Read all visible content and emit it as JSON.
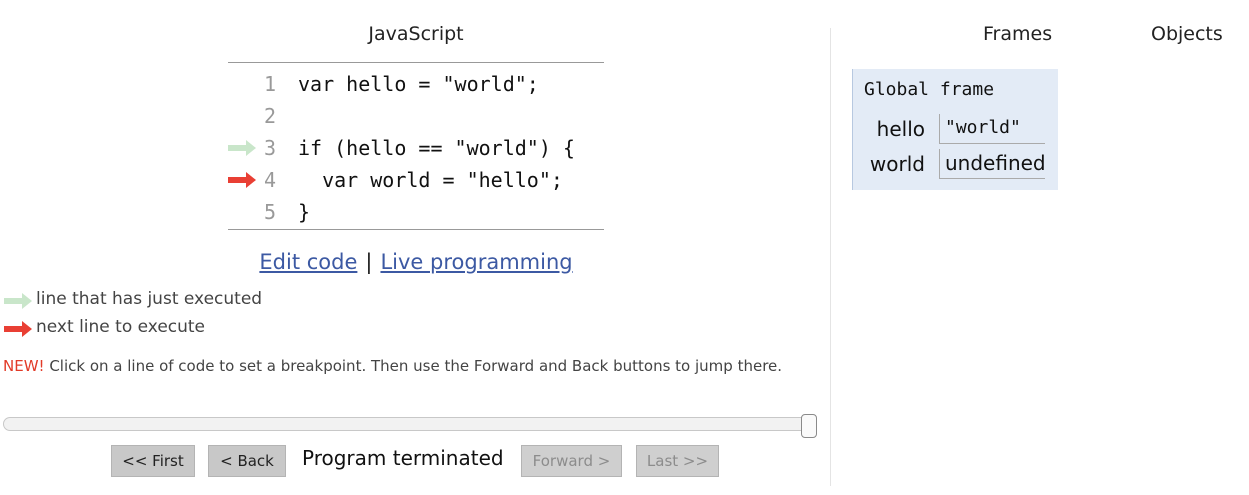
{
  "language_title": "JavaScript",
  "code_lines": [
    {
      "num": "1",
      "text": "var hello = \"world\";",
      "arrow": null
    },
    {
      "num": "2",
      "text": "",
      "arrow": null
    },
    {
      "num": "3",
      "text": "if (hello == \"world\") {",
      "arrow": "just-executed"
    },
    {
      "num": "4",
      "text": "  var world = \"hello\";",
      "arrow": "next"
    },
    {
      "num": "5",
      "text": "}",
      "arrow": null
    }
  ],
  "links": {
    "edit_code": "Edit code",
    "separator": "|",
    "live_programming": "Live programming"
  },
  "legend": {
    "just_executed": "line that has just executed",
    "next_line": "next line to execute"
  },
  "notice": {
    "new_label": "NEW!",
    "text": " Click on a line of code to set a breakpoint. Then use the Forward and Back buttons to jump there."
  },
  "slider": {
    "position_fraction": 1.0
  },
  "controls": {
    "first": "<< First",
    "back": "< Back",
    "status": "Program terminated",
    "forward": "Forward >",
    "last": "Last >>"
  },
  "viz": {
    "frames_header": "Frames",
    "objects_header": "Objects",
    "frame_title": "Global frame",
    "variables": [
      {
        "name": "hello",
        "value": "\"world\""
      },
      {
        "name": "world",
        "value": "undefined"
      }
    ]
  },
  "colors": {
    "just_executed_arrow": "#c9e6ca",
    "next_arrow": "#e93f34",
    "link": "#3c59a3",
    "frame_bg": "#e3ebf6"
  }
}
